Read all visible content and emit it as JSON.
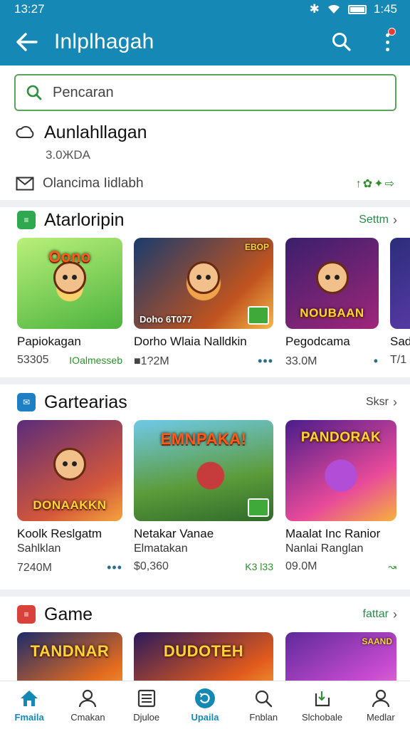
{
  "status_bar": {
    "time": "13:27",
    "right_time": "1:45"
  },
  "app_bar": {
    "title": "Inlplhagah"
  },
  "search": {
    "placeholder": "Pencaran"
  },
  "info": {
    "name": "Aunlahllagan",
    "sub": "3.0ЖDA",
    "line": "Olancima Iidlabh",
    "badges": "↑✿✦⇨"
  },
  "sections": [
    {
      "title": "Atarloripin",
      "more": "Settm",
      "icon_color": "#2fa84f",
      "cards": [
        {
          "art": "Oono",
          "line1": "Papiokagan",
          "line2": "",
          "stat": "53305",
          "tag": "IOalmesseb"
        },
        {
          "art": "",
          "caption": "Doho 6T077",
          "corner": "EBOP",
          "line1": "Dorho Wlaia Nalldkin",
          "line2": "",
          "stat": "■1?2M",
          "tag": "•••"
        },
        {
          "art": "NOUBAAN",
          "line1": "Pegodcama",
          "line2": "",
          "stat": "33.0M",
          "tag": "•"
        },
        {
          "art": "",
          "line1": "Sad",
          "line2": "",
          "stat": "T/1",
          "tag": ""
        }
      ]
    },
    {
      "title": "Gartearias",
      "more": "Sksr",
      "icon_color": "#1f7fc4",
      "cards": [
        {
          "art": "DONAAKKN",
          "line1": "Koolk Reslgatm",
          "line2": "Sahlklan",
          "stat": "7240M",
          "tag": "•••"
        },
        {
          "art": "EMNPAKA!",
          "line1": "Netakar Vanae",
          "line2": "Elmatakan",
          "stat": "$0,360",
          "tag": "K3 l33"
        },
        {
          "art": "PANDORAK",
          "line1": "Maalat Inc Ranior",
          "line2": "Nanlai Ranglan",
          "stat": "09.0M",
          "tag": "↝"
        }
      ]
    },
    {
      "title": "Game",
      "more": "fattar",
      "icon_color": "#d9423a",
      "cards": [
        {
          "art": "TANDNAR"
        },
        {
          "art": "DUDOTEH"
        },
        {
          "art": "SAAND"
        }
      ]
    }
  ],
  "bottom_nav": [
    {
      "label": "Fmaila",
      "icon": "home-icon",
      "active": true
    },
    {
      "label": "Cmakan",
      "icon": "person-icon",
      "active": false
    },
    {
      "label": "Djuloe",
      "icon": "list-icon",
      "active": false
    },
    {
      "label": "Upaila",
      "icon": "refresh-icon",
      "active": true
    },
    {
      "label": "Fnblan",
      "icon": "search-icon",
      "active": false
    },
    {
      "label": "Slchobale",
      "icon": "download-icon",
      "active": false
    },
    {
      "label": "Medlar",
      "icon": "person-icon",
      "active": false
    }
  ]
}
